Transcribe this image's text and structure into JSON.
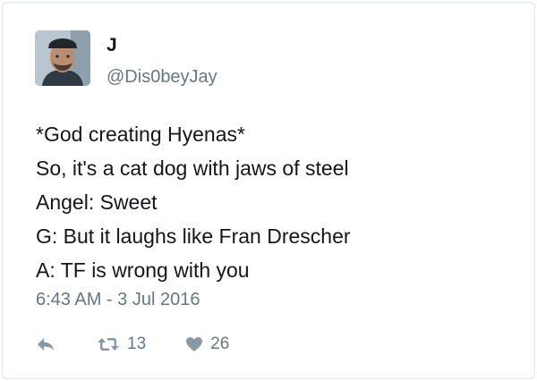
{
  "user": {
    "display_name": "J",
    "handle": "@Dis0beyJay"
  },
  "tweet": {
    "lines": [
      "*God creating Hyenas*",
      "So, it's a cat dog with jaws of steel",
      "Angel: Sweet",
      "G: But it laughs like Fran Drescher",
      "A: TF is wrong with you"
    ],
    "timestamp": "6:43 AM - 3 Jul 2016"
  },
  "actions": {
    "reply_icon": "reply-icon",
    "retweet_icon": "retweet-icon",
    "like_icon": "heart-icon",
    "retweet_count": "13",
    "like_count": "26"
  },
  "colors": {
    "text": "#14171a",
    "secondary": "#657786",
    "icon": "#8899a6",
    "border": "#e1e8ed"
  }
}
